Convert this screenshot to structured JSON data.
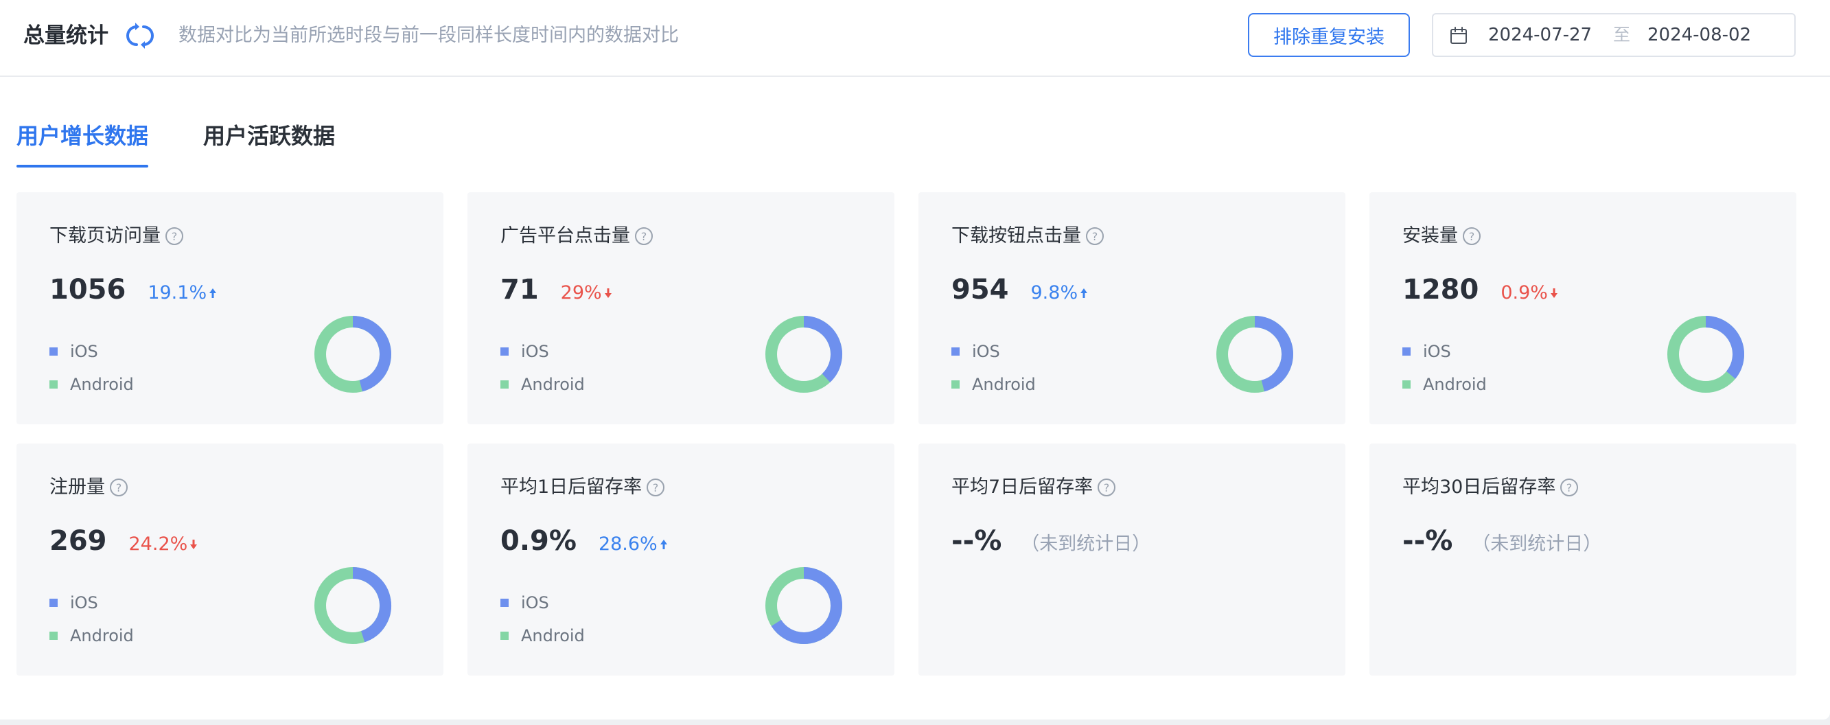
{
  "header": {
    "title": "总量统计",
    "description": "数据对比为当前所选时段与前一段同样长度时间内的数据对比",
    "dedupe_button": "排除重复安装",
    "date_start": "2024-07-27",
    "date_separator": "至",
    "date_end": "2024-08-02"
  },
  "tabs": [
    {
      "label": "用户增长数据",
      "active": true
    },
    {
      "label": "用户活跃数据",
      "active": false
    }
  ],
  "legend": {
    "ios": "iOS",
    "android": "Android"
  },
  "colors": {
    "ios": "#6e90ee",
    "android": "#84d6a5",
    "accent": "#2f76ee",
    "up": "#3a82ee",
    "down": "#e9534b"
  },
  "cards": [
    {
      "title": "下载页访问量",
      "value": "1056",
      "change": "19.1%",
      "direction": "up",
      "ios_fraction": 0.46
    },
    {
      "title": "广告平台点击量",
      "value": "71",
      "change": "29%",
      "direction": "down",
      "ios_fraction": 0.38
    },
    {
      "title": "下载按钮点击量",
      "value": "954",
      "change": "9.8%",
      "direction": "up",
      "ios_fraction": 0.46
    },
    {
      "title": "安装量",
      "value": "1280",
      "change": "0.9%",
      "direction": "down",
      "ios_fraction": 0.36
    },
    {
      "title": "注册量",
      "value": "269",
      "change": "24.2%",
      "direction": "down",
      "ios_fraction": 0.45
    },
    {
      "title": "平均1日后留存率",
      "value": "0.9%",
      "change": "28.6%",
      "direction": "up",
      "ios_fraction": 0.66
    },
    {
      "title": "平均7日后留存率",
      "value": "--%",
      "note": "（未到统计日）"
    },
    {
      "title": "平均30日后留存率",
      "value": "--%",
      "note": "（未到统计日）"
    }
  ]
}
